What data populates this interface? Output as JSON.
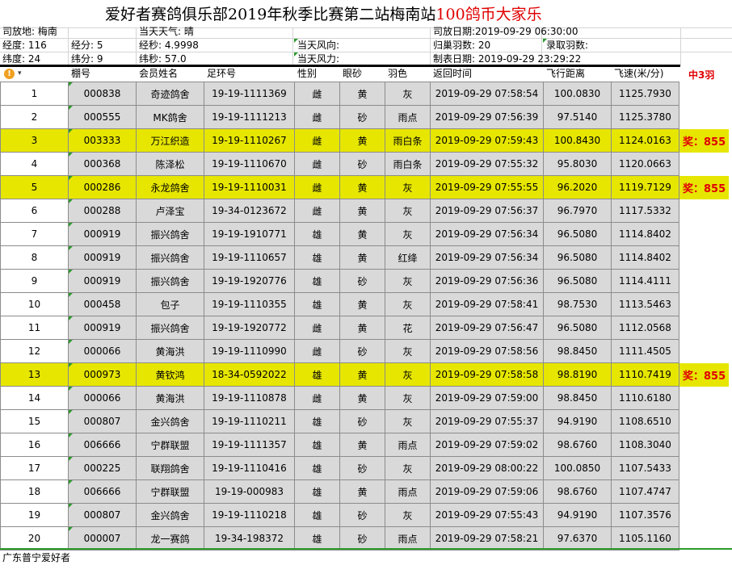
{
  "title": {
    "part1": "爱好者赛鸽俱乐部",
    "year": "2019",
    "part2": "年秋季比赛第二站梅南站",
    "prize": "100",
    "part3": "鸽币大家乐"
  },
  "info": {
    "location": "司放地: 梅南",
    "weather": "当天天气: 晴",
    "release_date": "司放日期:2019-09-29 06:30:00",
    "longitude": "经度: 116",
    "lon_min": "经分: 5",
    "lon_sec": "经秒: 4.9998",
    "wind_dir": "当天风向:",
    "returned": "归巢羽数: 20",
    "recorded": "录取羽数:",
    "latitude": "纬度:  24",
    "lat_min": "纬分: 9",
    "lat_sec": "纬秒: 57.0",
    "wind_force": "当天风力:",
    "made_date": "制表日期: 2019-09-29 23:29:22"
  },
  "headers": {
    "warn_icon": "!",
    "shed_no": "棚号",
    "member": "会员姓名",
    "ring": "足环号",
    "sex": "性别",
    "eye": "眼砂",
    "feather": "羽色",
    "return_time": "返回时间",
    "distance": "飞行距离",
    "speed": "飞速(米/分)",
    "prize_header": "中3羽"
  },
  "rows": [
    {
      "rank": "1",
      "shed": "000838",
      "name": "奇迹鸽舍",
      "ring": "19-19-1111369",
      "sex": "雌",
      "eye": "黄",
      "color": "灰",
      "time": "2019-09-29 07:58:54",
      "dist": "100.0830",
      "speed": "1125.7930",
      "prize": ""
    },
    {
      "rank": "2",
      "shed": "000555",
      "name": "MK鸽舍",
      "ring": "19-19-1111213",
      "sex": "雌",
      "eye": "砂",
      "color": "雨点",
      "time": "2019-09-29 07:56:39",
      "dist": "97.5140",
      "speed": "1125.3780",
      "prize": ""
    },
    {
      "rank": "3",
      "shed": "003333",
      "name": "万江织造",
      "ring": "19-19-1110267",
      "sex": "雌",
      "eye": "黄",
      "color": "雨白条",
      "time": "2019-09-29 07:59:43",
      "dist": "100.8430",
      "speed": "1124.0163",
      "prize": "奖：855"
    },
    {
      "rank": "4",
      "shed": "000368",
      "name": "陈泽松",
      "ring": "19-19-1110670",
      "sex": "雌",
      "eye": "砂",
      "color": "雨白条",
      "time": "2019-09-29 07:55:32",
      "dist": "95.8030",
      "speed": "1120.0663",
      "prize": ""
    },
    {
      "rank": "5",
      "shed": "000286",
      "name": "永龙鸽舍",
      "ring": "19-19-1110031",
      "sex": "雌",
      "eye": "黄",
      "color": "灰",
      "time": "2019-09-29 07:55:55",
      "dist": "96.2020",
      "speed": "1119.7129",
      "prize": "奖：855"
    },
    {
      "rank": "6",
      "shed": "000288",
      "name": "卢泽宝",
      "ring": "19-34-0123672",
      "sex": "雌",
      "eye": "黄",
      "color": "灰",
      "time": "2019-09-29 07:56:37",
      "dist": "96.7970",
      "speed": "1117.5332",
      "prize": ""
    },
    {
      "rank": "7",
      "shed": "000919",
      "name": "振兴鸽舍",
      "ring": "19-19-1910771",
      "sex": "雄",
      "eye": "黄",
      "color": "灰",
      "time": "2019-09-29 07:56:34",
      "dist": "96.5080",
      "speed": "1114.8402",
      "prize": ""
    },
    {
      "rank": "8",
      "shed": "000919",
      "name": "振兴鸽舍",
      "ring": "19-19-1110657",
      "sex": "雄",
      "eye": "黄",
      "color": "红绛",
      "time": "2019-09-29 07:56:34",
      "dist": "96.5080",
      "speed": "1114.8402",
      "prize": ""
    },
    {
      "rank": "9",
      "shed": "000919",
      "name": "振兴鸽舍",
      "ring": "19-19-1920776",
      "sex": "雄",
      "eye": "砂",
      "color": "灰",
      "time": "2019-09-29 07:56:36",
      "dist": "96.5080",
      "speed": "1114.4111",
      "prize": ""
    },
    {
      "rank": "10",
      "shed": "000458",
      "name": "包子",
      "ring": "19-19-1110355",
      "sex": "雄",
      "eye": "黄",
      "color": "灰",
      "time": "2019-09-29 07:58:41",
      "dist": "98.7530",
      "speed": "1113.5463",
      "prize": ""
    },
    {
      "rank": "11",
      "shed": "000919",
      "name": "振兴鸽舍",
      "ring": "19-19-1920772",
      "sex": "雌",
      "eye": "黄",
      "color": "花",
      "time": "2019-09-29 07:56:47",
      "dist": "96.5080",
      "speed": "1112.0568",
      "prize": ""
    },
    {
      "rank": "12",
      "shed": "000066",
      "name": "黄海洪",
      "ring": "19-19-1110990",
      "sex": "雌",
      "eye": "砂",
      "color": "灰",
      "time": "2019-09-29 07:58:56",
      "dist": "98.8450",
      "speed": "1111.4505",
      "prize": ""
    },
    {
      "rank": "13",
      "shed": "000973",
      "name": "黄钦鸿",
      "ring": "18-34-0592022",
      "sex": "雄",
      "eye": "黄",
      "color": "灰",
      "time": "2019-09-29 07:58:58",
      "dist": "98.8190",
      "speed": "1110.7419",
      "prize": "奖：855"
    },
    {
      "rank": "14",
      "shed": "000066",
      "name": "黄海洪",
      "ring": "19-19-1110878",
      "sex": "雌",
      "eye": "黄",
      "color": "灰",
      "time": "2019-09-29 07:59:00",
      "dist": "98.8450",
      "speed": "1110.6180",
      "prize": ""
    },
    {
      "rank": "15",
      "shed": "000807",
      "name": "金兴鸽舍",
      "ring": "19-19-1110211",
      "sex": "雄",
      "eye": "砂",
      "color": "灰",
      "time": "2019-09-29 07:55:37",
      "dist": "94.9190",
      "speed": "1108.6510",
      "prize": ""
    },
    {
      "rank": "16",
      "shed": "006666",
      "name": "宁群联盟",
      "ring": "19-19-1111357",
      "sex": "雄",
      "eye": "黄",
      "color": "雨点",
      "time": "2019-09-29 07:59:02",
      "dist": "98.6760",
      "speed": "1108.3040",
      "prize": ""
    },
    {
      "rank": "17",
      "shed": "000225",
      "name": "联翔鸽舍",
      "ring": "19-19-1110416",
      "sex": "雄",
      "eye": "砂",
      "color": "灰",
      "time": "2019-09-29 08:00:22",
      "dist": "100.0850",
      "speed": "1107.5433",
      "prize": ""
    },
    {
      "rank": "18",
      "shed": "006666",
      "name": "宁群联盟",
      "ring": "19-19-000983",
      "sex": "雄",
      "eye": "黄",
      "color": "雨点",
      "time": "2019-09-29 07:59:06",
      "dist": "98.6760",
      "speed": "1107.4747",
      "prize": ""
    },
    {
      "rank": "19",
      "shed": "000807",
      "name": "金兴鸽舍",
      "ring": "19-19-1110218",
      "sex": "雄",
      "eye": "砂",
      "color": "灰",
      "time": "2019-09-29 07:55:43",
      "dist": "94.9190",
      "speed": "1107.3576",
      "prize": ""
    },
    {
      "rank": "20",
      "shed": "000007",
      "name": "龙一赛鸽",
      "ring": "19-34-198372",
      "sex": "雄",
      "eye": "砂",
      "color": "雨点",
      "time": "2019-09-29 07:58:21",
      "dist": "97.6370",
      "speed": "1105.1160",
      "prize": ""
    }
  ],
  "highlight_ranks": [
    "3",
    "5",
    "13"
  ],
  "footer": "广东普宁爱好者",
  "colors": {
    "highlight": "#e6e600",
    "row_bg": "#d9d9d9",
    "prize_text": "#e00000",
    "title_red": "#e00000"
  }
}
